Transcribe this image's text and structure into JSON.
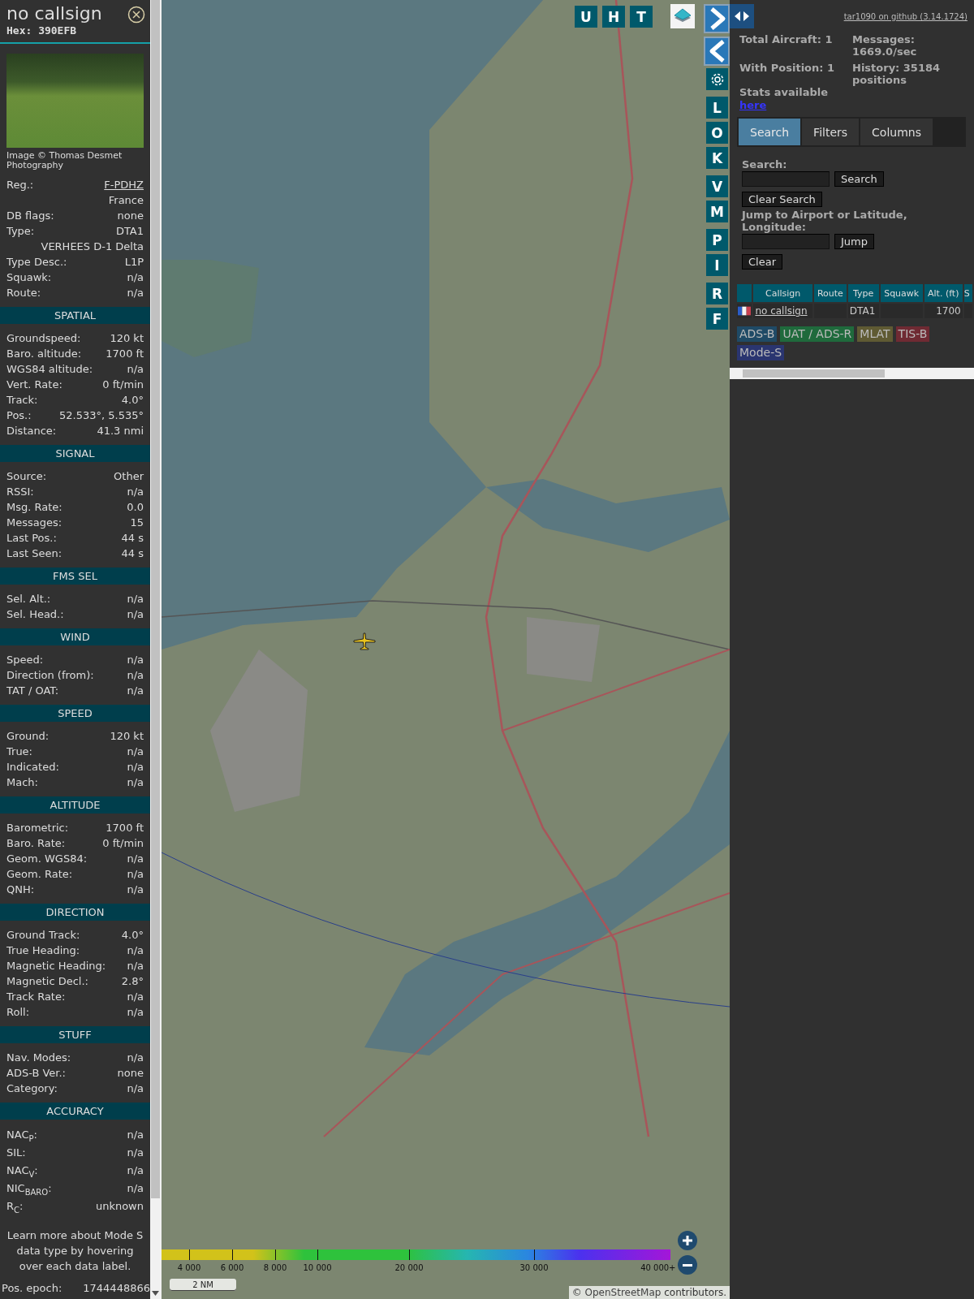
{
  "aircraft": {
    "callsign": "no callsign",
    "hex": "Hex: 390EFB",
    "photo_credit": "Image © Thomas Desmet Photography",
    "rows": [
      {
        "kind": "link",
        "label": "Reg.:",
        "value": "F-PDHZ"
      },
      {
        "kind": "value",
        "value": "France"
      },
      {
        "kind": "pair",
        "label": "DB flags:",
        "value": "none"
      },
      {
        "kind": "pair",
        "label": "Type:",
        "value": "DTA1"
      },
      {
        "kind": "value",
        "value": "VERHEES D-1 Delta"
      },
      {
        "kind": "pair",
        "label": "Type Desc.:",
        "value": "L1P"
      },
      {
        "kind": "pair",
        "label": "Squawk:",
        "value": "n/a"
      },
      {
        "kind": "pair",
        "label": "Route:",
        "value": "n/a"
      }
    ]
  },
  "sections": [
    {
      "title": "SPATIAL",
      "rows": [
        {
          "label": "Groundspeed:",
          "value": "120 kt"
        },
        {
          "label": "Baro. altitude:",
          "value": "1700 ft"
        },
        {
          "label": "WGS84 altitude:",
          "value": "n/a"
        },
        {
          "label": "Vert. Rate:",
          "value": "0 ft/min"
        },
        {
          "label": "Track:",
          "value": "4.0°"
        },
        {
          "label": "Pos.:",
          "value": "52.533°, 5.535°"
        },
        {
          "label": "Distance:",
          "value": "41.3 nmi"
        }
      ]
    },
    {
      "title": "SIGNAL",
      "rows": [
        {
          "label": "Source:",
          "value": "Other"
        },
        {
          "label": "RSSI:",
          "value": "n/a"
        },
        {
          "label": "Msg. Rate:",
          "value": "0.0"
        },
        {
          "label": "Messages:",
          "value": "15"
        },
        {
          "label": "Last Pos.:",
          "value": "44 s"
        },
        {
          "label": "Last Seen:",
          "value": "44 s"
        }
      ]
    },
    {
      "title": "FMS SEL",
      "rows": [
        {
          "label": "Sel. Alt.:",
          "value": "n/a"
        },
        {
          "label": "Sel. Head.:",
          "value": "n/a"
        }
      ]
    },
    {
      "title": "WIND",
      "rows": [
        {
          "label": "Speed:",
          "value": "n/a"
        },
        {
          "label": "Direction (from):",
          "value": "n/a"
        },
        {
          "label": "TAT / OAT:",
          "value": "n/a"
        }
      ]
    },
    {
      "title": "SPEED",
      "rows": [
        {
          "label": "Ground:",
          "value": "120 kt"
        },
        {
          "label": "True:",
          "value": "n/a"
        },
        {
          "label": "Indicated:",
          "value": "n/a"
        },
        {
          "label": "Mach:",
          "value": "n/a"
        }
      ]
    },
    {
      "title": "ALTITUDE",
      "rows": [
        {
          "label": "Barometric:",
          "value": "1700 ft"
        },
        {
          "label": "Baro. Rate:",
          "value": "0 ft/min"
        },
        {
          "label": "Geom. WGS84:",
          "value": "n/a"
        },
        {
          "label": "Geom. Rate:",
          "value": "n/a"
        },
        {
          "label": "QNH:",
          "value": "n/a"
        }
      ]
    },
    {
      "title": "DIRECTION",
      "rows": [
        {
          "label": "Ground Track:",
          "value": "4.0°"
        },
        {
          "label": "True Heading:",
          "value": "n/a"
        },
        {
          "label": "Magnetic Heading:",
          "value": "n/a"
        },
        {
          "label": "Magnetic Decl.:",
          "value": "2.8°"
        },
        {
          "label": "Track Rate:",
          "value": "n/a"
        },
        {
          "label": "Roll:",
          "value": "n/a"
        }
      ]
    },
    {
      "title": "STUFF",
      "rows": [
        {
          "label": "Nav. Modes:",
          "value": "n/a"
        },
        {
          "label": "ADS-B Ver.:",
          "value": "none"
        },
        {
          "label": "Category:",
          "value": "n/a"
        }
      ]
    },
    {
      "title": "ACCURACY",
      "rows": [
        {
          "label": "NAC$_{P}$:",
          "value": "n/a"
        },
        {
          "label": "SIL:",
          "value": "n/a"
        },
        {
          "label": "NAC$_{V}$:",
          "value": "n/a"
        },
        {
          "label": "NIC$_{BARO}$:",
          "value": "n/a"
        },
        {
          "label": "R$_{C}$:",
          "value": "unknown"
        }
      ]
    }
  ],
  "footer": {
    "note": "Learn more about Mode S data type by hovering over each data label.",
    "label": "Pos. epoch:",
    "value": "1744448866"
  },
  "map": {
    "top_buttons": [
      "U",
      "H",
      "T"
    ],
    "side_groups": [
      [
        "L",
        "O",
        "K"
      ],
      [
        "V",
        "M"
      ],
      [
        "P",
        "I"
      ],
      [
        "R",
        "F"
      ]
    ],
    "altitude_legend": [
      "4 000",
      "6 000",
      "8 000",
      "10 000",
      "20 000",
      "30 000",
      "40 000+"
    ],
    "scale": "2 NM",
    "attribution": {
      "prefix": "©",
      "link": "OpenStreetMap",
      "suffix": "contributors."
    }
  },
  "panel": {
    "github_link": "tar1090 on github (3.14.1724)",
    "stats": [
      {
        "label": "Total Aircraft:",
        "value": "1"
      },
      {
        "label": "Messages:",
        "value": "1669.0/sec"
      },
      {
        "label": "With Position:",
        "value": "1"
      },
      {
        "label": "History:",
        "value": "35184 positions"
      }
    ],
    "stats_note": "Stats available",
    "stats_link": "here",
    "tabs": [
      {
        "label": "Search",
        "selected": true
      },
      {
        "label": "Filters",
        "selected": false
      },
      {
        "label": "Columns",
        "selected": false
      }
    ],
    "search_label": "Search:",
    "search_button": "Search",
    "clear_search_button": "Clear Search",
    "jump_label": "Jump to Airport or Latitude, Longitude:",
    "jump_button": "Jump",
    "clear_button": "Clear",
    "table": {
      "columns": [
        "Callsign",
        "Route",
        "Type",
        "Squawk",
        "Alt. (ft)",
        "S"
      ],
      "rows": [
        {
          "cells": [
            "no callsign",
            null,
            "DTA1",
            null,
            "1700",
            null
          ]
        }
      ]
    },
    "legend": [
      {
        "label": "ADS-B",
        "color": "#1f4a66"
      },
      {
        "label": "UAT / ADS-R",
        "color": "#1f6a3c"
      },
      {
        "label": "MLAT",
        "color": "#5f5a33"
      },
      {
        "label": "TIS-B",
        "color": "#6f2a33"
      },
      {
        "label": "Mode-S",
        "color": "#2a3570"
      }
    ]
  }
}
